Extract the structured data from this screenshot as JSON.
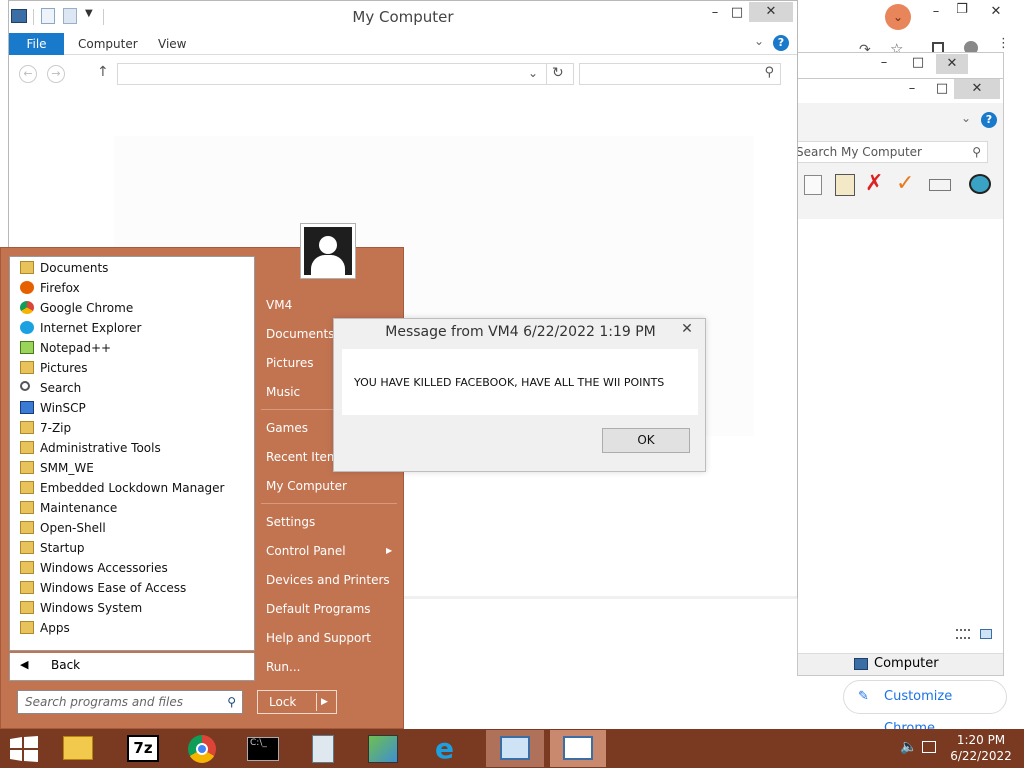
{
  "explorer_main": {
    "title": "My Computer",
    "ribbon_tabs": {
      "file": "File",
      "computer": "Computer",
      "view": "View"
    },
    "window_buttons": {
      "minimize": "–",
      "maximize": "□",
      "close": "✕"
    }
  },
  "explorer_second": {
    "search_placeholder": "Search My Computer",
    "status_text": "Computer"
  },
  "start_menu": {
    "programs": [
      {
        "label": "Documents",
        "icon": "folder-doc-icon"
      },
      {
        "label": "Firefox",
        "icon": "firefox-icon"
      },
      {
        "label": "Google Chrome",
        "icon": "chrome-icon"
      },
      {
        "label": "Internet Explorer",
        "icon": "ie-icon"
      },
      {
        "label": "Notepad++",
        "icon": "notepadpp-icon"
      },
      {
        "label": "Pictures",
        "icon": "folder-pictures-icon"
      },
      {
        "label": "Search",
        "icon": "search-icon"
      },
      {
        "label": "WinSCP",
        "icon": "winscp-icon"
      },
      {
        "label": "7-Zip",
        "icon": "folder-icon"
      },
      {
        "label": "Administrative Tools",
        "icon": "folder-icon"
      },
      {
        "label": "SMM_WE",
        "icon": "folder-icon"
      },
      {
        "label": "Embedded Lockdown Manager",
        "icon": "folder-icon"
      },
      {
        "label": "Maintenance",
        "icon": "folder-icon"
      },
      {
        "label": "Open-Shell",
        "icon": "folder-icon"
      },
      {
        "label": "Startup",
        "icon": "folder-icon"
      },
      {
        "label": "Windows Accessories",
        "icon": "folder-icon"
      },
      {
        "label": "Windows Ease of Access",
        "icon": "folder-icon"
      },
      {
        "label": "Windows System",
        "icon": "folder-icon"
      },
      {
        "label": "Apps",
        "icon": "folder-icon"
      }
    ],
    "back_label": "Back",
    "search_placeholder": "Search programs and files",
    "right_items": {
      "vm4": "VM4",
      "documents": "Documents",
      "pictures": "Pictures",
      "music": "Music",
      "games": "Games",
      "recent_items": "Recent Items",
      "my_computer": "My Computer",
      "settings": "Settings",
      "control_panel": "Control Panel",
      "devices_printers": "Devices and Printers",
      "default_programs": "Default Programs",
      "help_support": "Help and Support",
      "run": "Run..."
    },
    "lock_label": "Lock"
  },
  "dialog": {
    "title": "Message from VM4 6/22/2022 1:19 PM",
    "message": "YOU HAVE KILLED FACEBOOK, HAVE ALL THE WII POINTS",
    "ok_label": "OK"
  },
  "chrome": {
    "customize_label": "Customize Chrome"
  },
  "taskbar": {
    "time": "1:20 PM",
    "date": "6/22/2022",
    "seven_zip_label": "7z"
  },
  "colors": {
    "start_menu_bg": "#c27451",
    "taskbar_bg": "#7a3a22",
    "ribbon_file_tab": "#1979ca"
  }
}
